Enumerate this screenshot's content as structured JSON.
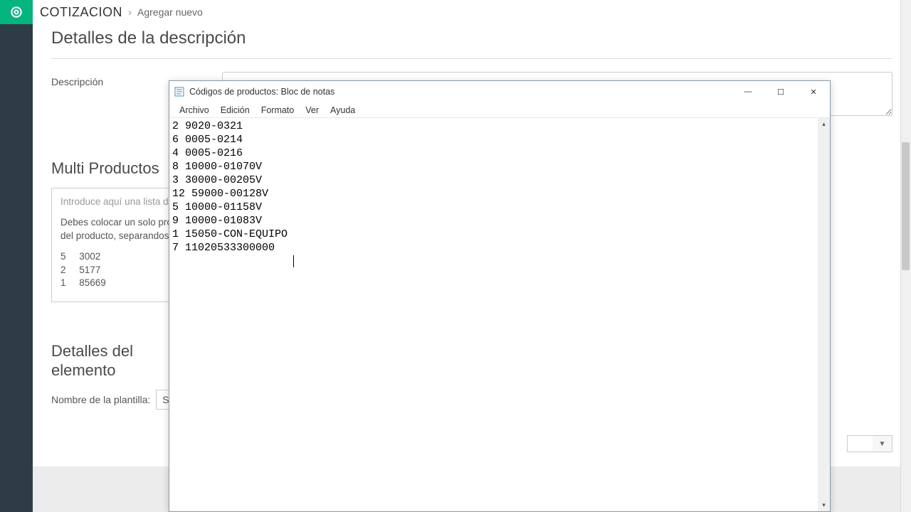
{
  "topbar": {
    "title": "Cotizacion",
    "subtitle": "Agregar nuevo"
  },
  "description": {
    "section_title": "Detalles de la descripción",
    "label": "Descripción"
  },
  "multi": {
    "title": "Multi Productos",
    "placeholder_line": "Introduce aquí una lista de productos y sus cantidades.",
    "instructions": "Debes colocar un solo producto por línea, primero la cantidad y después el código del producto, separandos por un espacio o tabulador. Ej:",
    "example": "5     3002\n2     5177\n1     85669"
  },
  "element": {
    "title": "Detalles del\nelemento",
    "template_label": "Nombre de la plantilla:",
    "template_value_prefix": "S"
  },
  "notepad": {
    "window_title": "Códigos de productos: Bloc de notas",
    "menu": {
      "file": "Archivo",
      "edit": "Edición",
      "format": "Formato",
      "view": "Ver",
      "help": "Ayuda"
    },
    "content": "2 9020-0321\n6 0005-0214\n4 0005-0216\n8 10000-01070V\n3 30000-00205V\n12 59000-00128V\n5 10000-01158V\n9 10000-01083V\n1 15050-CON-EQUIPO\n7 11020533300000"
  }
}
